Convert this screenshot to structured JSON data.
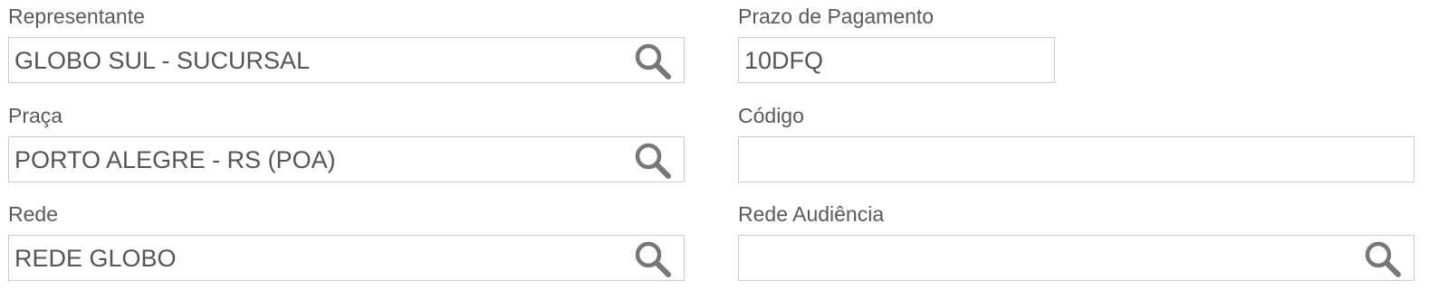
{
  "left_column": {
    "representante": {
      "label": "Representante",
      "value": "GLOBO SUL - SUCURSAL",
      "icon": "search-icon"
    },
    "praca": {
      "label": "Praça",
      "value": "PORTO ALEGRE - RS (POA)",
      "icon": "search-icon"
    },
    "rede": {
      "label": "Rede",
      "value": "REDE GLOBO",
      "icon": "search-icon"
    }
  },
  "right_column": {
    "prazo_pagamento": {
      "label": "Prazo de Pagamento",
      "value": "10DFQ"
    },
    "codigo": {
      "label": "Código",
      "value": ""
    },
    "rede_audiencia": {
      "label": "Rede Audiência",
      "value": "",
      "icon": "search-icon"
    }
  },
  "colors": {
    "border": "#cccccc",
    "text": "#555555",
    "icon": "#777777"
  }
}
